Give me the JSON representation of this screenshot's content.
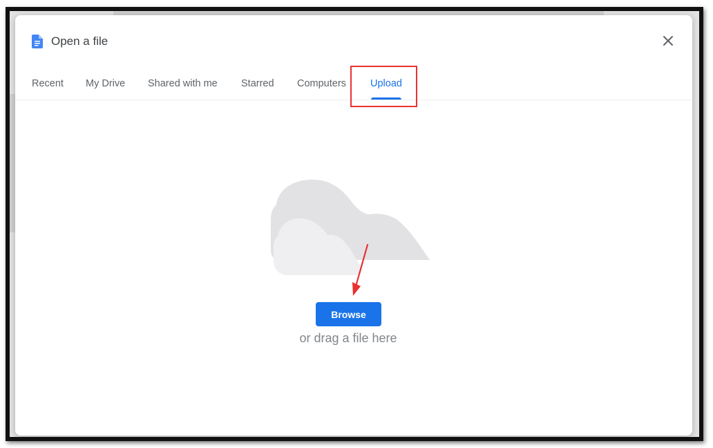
{
  "dialog": {
    "title": "Open a file",
    "title_icon": "google-docs-icon",
    "close_icon": "close-icon"
  },
  "tabs": [
    {
      "label": "Recent",
      "active": false
    },
    {
      "label": "My Drive",
      "active": false
    },
    {
      "label": "Shared with me",
      "active": false
    },
    {
      "label": "Starred",
      "active": false
    },
    {
      "label": "Computers",
      "active": false
    },
    {
      "label": "Upload",
      "active": true
    }
  ],
  "upload": {
    "illustration_icon": "cloud-icon",
    "browse_label": "Browse",
    "drag_text": "or drag a file here"
  },
  "annotations": {
    "highlight_color": "#e8312f",
    "arrow_color": "#e8312f"
  },
  "colors": {
    "accent": "#1a73e8",
    "text_secondary": "#5f6368",
    "cloud_light": "#eeeef0",
    "cloud_dark": "#e1e1e4"
  }
}
